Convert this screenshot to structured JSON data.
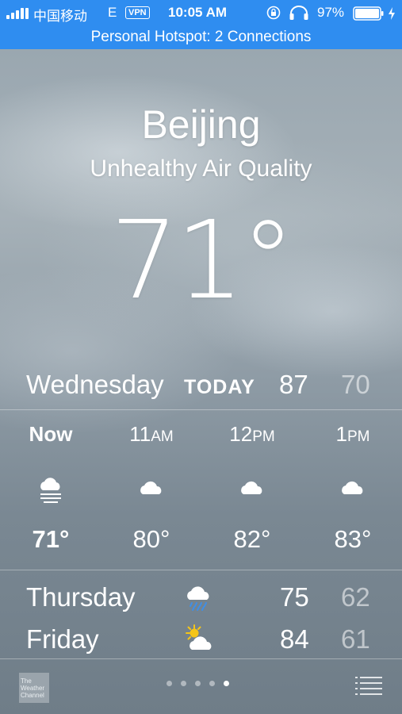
{
  "status_bar": {
    "carrier": "中国移动",
    "network": "E",
    "vpn": "VPN",
    "time": "10:05 AM",
    "battery": "97%"
  },
  "hotspot": "Personal Hotspot: 2 Connections",
  "location": {
    "city": "Beijing",
    "condition": "Unhealthy Air Quality",
    "temperature": "71°"
  },
  "today": {
    "day": "Wednesday",
    "label": "TODAY",
    "high": "87",
    "low": "70"
  },
  "hourly": [
    {
      "time": "Now",
      "suffix": "",
      "icon": "fog-icon",
      "temp": "71°"
    },
    {
      "time": "11",
      "suffix": "AM",
      "icon": "cloud-icon",
      "temp": "80°"
    },
    {
      "time": "12",
      "suffix": "PM",
      "icon": "cloud-icon",
      "temp": "82°"
    },
    {
      "time": "1",
      "suffix": "PM",
      "icon": "cloud-icon",
      "temp": "83°"
    }
  ],
  "daily": [
    {
      "day": "Thursday",
      "icon": "rain-cloud-icon",
      "high": "75",
      "low": "62"
    },
    {
      "day": "Friday",
      "icon": "partly-sunny-icon",
      "high": "84",
      "low": "61"
    }
  ],
  "footer": {
    "logo_text": "The Weather Channel",
    "pages": 5,
    "active_page": 5
  },
  "colors": {
    "status_bar": "#2f8df0",
    "text": "#ffffff"
  }
}
